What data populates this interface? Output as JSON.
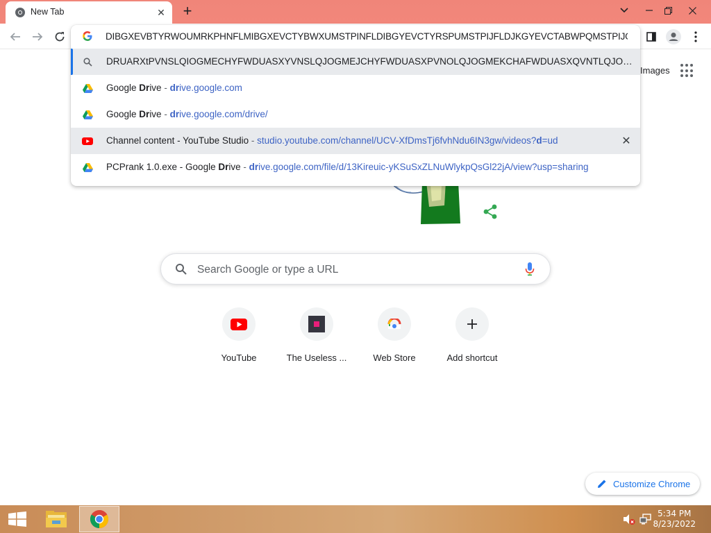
{
  "browser": {
    "tab": {
      "title": "New Tab"
    },
    "omnibox": {
      "input_text": "DIBGXEVBTYRWOUMRKPHNFLMIBGXEVCTYBWXUMSTPINFLDIBGYEVCTYRSPUMSTPIJFLDJKGYEVCTABWPQMSTPIJGLDJBS",
      "suggestions": [
        {
          "type": "search",
          "icon": "search-icon",
          "text": "DRUARXtPVNSLQIOGMECHYFWDUASXYVNSLQJOGMEJCHYFWDUASXPVNOLQJOGMEKCHAFWDUASXQVNTLQJOGMEKC...",
          "selected": true
        },
        {
          "type": "bookmark",
          "icon": "google-drive-icon",
          "title_pre": "Google ",
          "title_bold": "Dr",
          "title_post": "ive",
          "dash": " - ",
          "url_bold": "dr",
          "url_rest": "ive.google.com"
        },
        {
          "type": "bookmark",
          "icon": "google-drive-icon",
          "title_pre": "Google ",
          "title_bold": "Dr",
          "title_post": "ive",
          "dash": " - ",
          "url_bold": "dr",
          "url_rest": "ive.google.com/drive/"
        },
        {
          "type": "history",
          "icon": "youtube-icon",
          "title": "Channel content - YouTube Studio",
          "dash": " - ",
          "url_pre": "studio.youtube.com/channel/UCV-XfDmsTj6fvhNdu6IN3gw/videos?",
          "url_bold": "d",
          "url_post": "=ud",
          "hovered": true
        },
        {
          "type": "history",
          "icon": "google-drive-icon",
          "title_pre": "PCPrank 1.0.exe - Google ",
          "title_bold": "Dr",
          "title_post": "ive",
          "dash": " - ",
          "url_bold": "dr",
          "url_rest": "ive.google.com/file/d/13Kireuic-yKSuSxZLNuWlykpQsGl22jA/view?usp=sharing"
        }
      ]
    }
  },
  "ntp": {
    "images_link": "Images",
    "search_placeholder": "Search Google or type a URL",
    "shortcuts": [
      {
        "label": "YouTube",
        "icon": "youtube-icon"
      },
      {
        "label": "The Useless ...",
        "icon": "useless-web-icon"
      },
      {
        "label": "Web Store",
        "icon": "web-store-icon"
      },
      {
        "label": "Add shortcut",
        "icon": "plus-icon"
      }
    ],
    "customize_label": "Customize Chrome"
  },
  "taskbar": {
    "time": "5:34 PM",
    "date": "8/23/2022"
  },
  "colors": {
    "tabstrip": "#f2877b",
    "link_blue": "#3d63c4",
    "accent": "#1a73e8"
  }
}
